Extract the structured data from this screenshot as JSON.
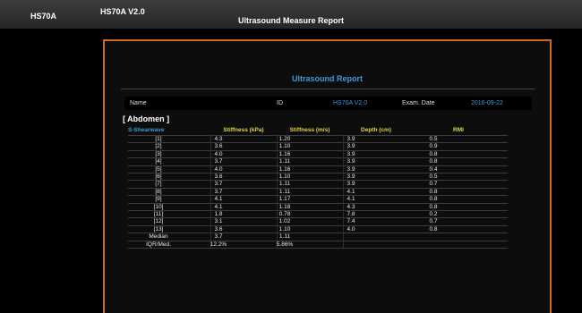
{
  "header": {
    "app_name": "HS70A",
    "version": "HS70A V2.0",
    "title": "Ultrasound Measure Report"
  },
  "report": {
    "title": "Ultrasound Report",
    "info": {
      "name_label": "Name",
      "id_label": "ID",
      "id_value": "HS70A V2.0",
      "exam_date_label": "Exam. Date",
      "exam_date_value": "2016-09-22"
    },
    "section_title": "[ Abdomen ]",
    "columns": [
      "S-Shearwave",
      "Stiffness (kPa)",
      "Stiffness (m/s)",
      "Depth (cm)",
      "RMI"
    ],
    "rows": [
      {
        "label": "[1]",
        "kpa": "4.3",
        "ms": "1.20",
        "depth": "3.9",
        "rmi": "0.5"
      },
      {
        "label": "[2]",
        "kpa": "3.6",
        "ms": "1.10",
        "depth": "3.9",
        "rmi": "0.9"
      },
      {
        "label": "[3]",
        "kpa": "4.0",
        "ms": "1.16",
        "depth": "3.9",
        "rmi": "0.8"
      },
      {
        "label": "[4]",
        "kpa": "3.7",
        "ms": "1.11",
        "depth": "3.9",
        "rmi": "0.8"
      },
      {
        "label": "[5]",
        "kpa": "4.0",
        "ms": "1.16",
        "depth": "3.9",
        "rmi": "0.4"
      },
      {
        "label": "[6]",
        "kpa": "3.6",
        "ms": "1.10",
        "depth": "3.9",
        "rmi": "0.5"
      },
      {
        "label": "[7]",
        "kpa": "3.7",
        "ms": "1.11",
        "depth": "3.9",
        "rmi": "0.7"
      },
      {
        "label": "[8]",
        "kpa": "3.7",
        "ms": "1.11",
        "depth": "4.1",
        "rmi": "0.8"
      },
      {
        "label": "[9]",
        "kpa": "4.1",
        "ms": "1.17",
        "depth": "4.1",
        "rmi": "0.8"
      },
      {
        "label": "[10]",
        "kpa": "4.1",
        "ms": "1.18",
        "depth": "4.3",
        "rmi": "0.8"
      },
      {
        "label": "[11]",
        "kpa": "1.8",
        "ms": "0.78",
        "depth": "7.8",
        "rmi": "0.2"
      },
      {
        "label": "[12]",
        "kpa": "3.1",
        "ms": "1.02",
        "depth": "7.4",
        "rmi": "0.7"
      },
      {
        "label": "[13]",
        "kpa": "3.6",
        "ms": "1.10",
        "depth": "4.0",
        "rmi": "0.8"
      }
    ],
    "summary": [
      {
        "label": "Median",
        "kpa": "3.7",
        "ms": "1.11"
      },
      {
        "label": "IQR/Med.",
        "kpa": "12.2%",
        "ms": "5.86%"
      }
    ]
  },
  "colors": {
    "frame_border": "#d2691e",
    "accent_blue": "#3e9bd6",
    "header_yellow": "#e8d24a",
    "topbar": "#303030"
  }
}
